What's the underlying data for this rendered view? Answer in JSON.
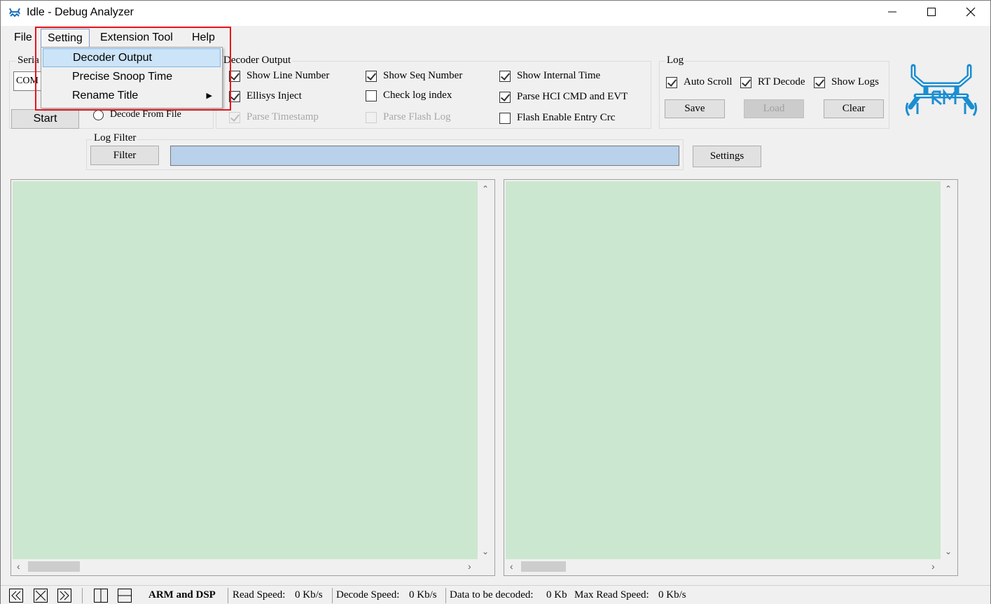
{
  "window": {
    "title": "Idle - Debug Analyzer"
  },
  "menubar": {
    "file": "File",
    "setting": "Setting",
    "extension_tool": "Extension Tool",
    "help": "Help"
  },
  "setting_menu": {
    "items": [
      {
        "label": "Decoder Output",
        "highlighted": true
      },
      {
        "label": "Precise Snoop Time"
      },
      {
        "label": "Rename Title",
        "has_submenu": true
      }
    ]
  },
  "serial": {
    "label": "Seria",
    "value": "COM"
  },
  "start_button": "Start",
  "decode_from_file": "Decode From File",
  "decoder_output": {
    "label": "Decoder Output",
    "options": {
      "show_line_number": {
        "label": "Show Line Number",
        "checked": true
      },
      "ellisys_inject": {
        "label": "Ellisys Inject",
        "checked": true
      },
      "parse_timestamp": {
        "label": "Parse Timestamp",
        "checked": true,
        "disabled": true
      },
      "show_seq_number": {
        "label": "Show Seq Number",
        "checked": true
      },
      "check_log_index": {
        "label": "Check log index",
        "checked": false
      },
      "parse_flash_log": {
        "label": "Parse Flash Log",
        "checked": false,
        "disabled": true
      },
      "show_internal_time": {
        "label": "Show Internal Time",
        "checked": true
      },
      "parse_hci": {
        "label": "Parse HCI CMD and EVT",
        "checked": true
      },
      "flash_enable_entry_crc": {
        "label": "Flash Enable Entry Crc",
        "checked": false
      }
    }
  },
  "log": {
    "label": "Log",
    "auto_scroll": {
      "label": "Auto Scroll",
      "checked": true
    },
    "rt_decode": {
      "label": "RT Decode",
      "checked": true
    },
    "show_logs": {
      "label": "Show Logs",
      "checked": true
    },
    "save": "Save",
    "load": "Load",
    "clear": "Clear"
  },
  "log_filter": {
    "label": "Log Filter",
    "button": "Filter",
    "value": ""
  },
  "settings_button": "Settings",
  "statusbar": {
    "mode": "ARM and DSP",
    "read_speed_label": "Read Speed:",
    "read_speed": "0 Kb/s",
    "decode_speed_label": "Decode Speed:",
    "decode_speed": "0 Kb/s",
    "data_to_decode_label": "Data to be decoded:",
    "data_to_decode": "0 Kb",
    "max_read_speed_label": "Max Read Speed:",
    "max_read_speed": "0 Kb/s"
  },
  "colors": {
    "pane_bg": "#cce7cf",
    "highlight_border": "#e8141c",
    "logo_blue": "#1b8ed1"
  },
  "icons": [
    "app-crab-icon",
    "minimize-icon",
    "maximize-icon",
    "close-icon",
    "submenu-arrow-icon",
    "realtek-logo",
    "first-page-icon",
    "close-page-icon",
    "last-page-icon",
    "split-vertical-icon",
    "split-horizontal-icon"
  ]
}
